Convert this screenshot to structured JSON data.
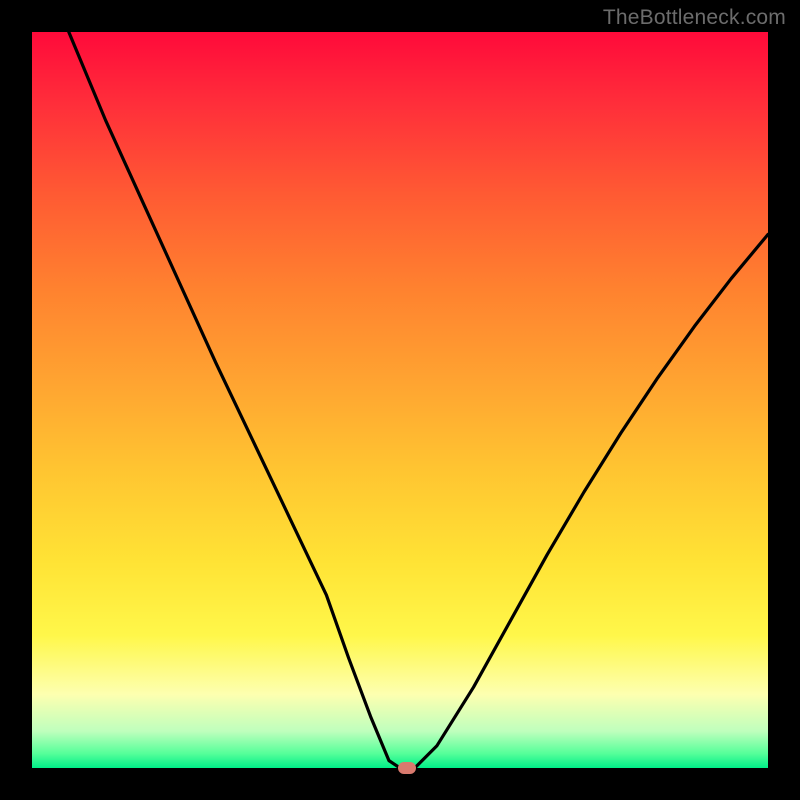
{
  "watermark": "TheBottleneck.com",
  "colors": {
    "frame": "#000000",
    "gradient_top": "#ff0a3a",
    "gradient_bottom": "#00ef88",
    "curve": "#000000",
    "marker": "#d97a6e"
  },
  "chart_data": {
    "type": "line",
    "title": "",
    "xlabel": "",
    "ylabel": "",
    "xlim": [
      0,
      100
    ],
    "ylim": [
      0,
      100
    ],
    "grid": false,
    "legend": false,
    "series": [
      {
        "name": "bottleneck-curve",
        "x": [
          5,
          10,
          15,
          20,
          25,
          30,
          35,
          40,
          43,
          46,
          48.5,
          50,
          52,
          55,
          60,
          65,
          70,
          75,
          80,
          85,
          90,
          95,
          100
        ],
        "values": [
          100,
          88,
          77,
          66,
          55,
          44.5,
          34,
          23.5,
          15,
          7,
          1,
          0,
          0,
          3,
          11,
          20,
          29,
          37.5,
          45.5,
          53,
          60,
          66.5,
          72.5
        ]
      }
    ],
    "marker": {
      "x": 51,
      "y": 0
    }
  }
}
